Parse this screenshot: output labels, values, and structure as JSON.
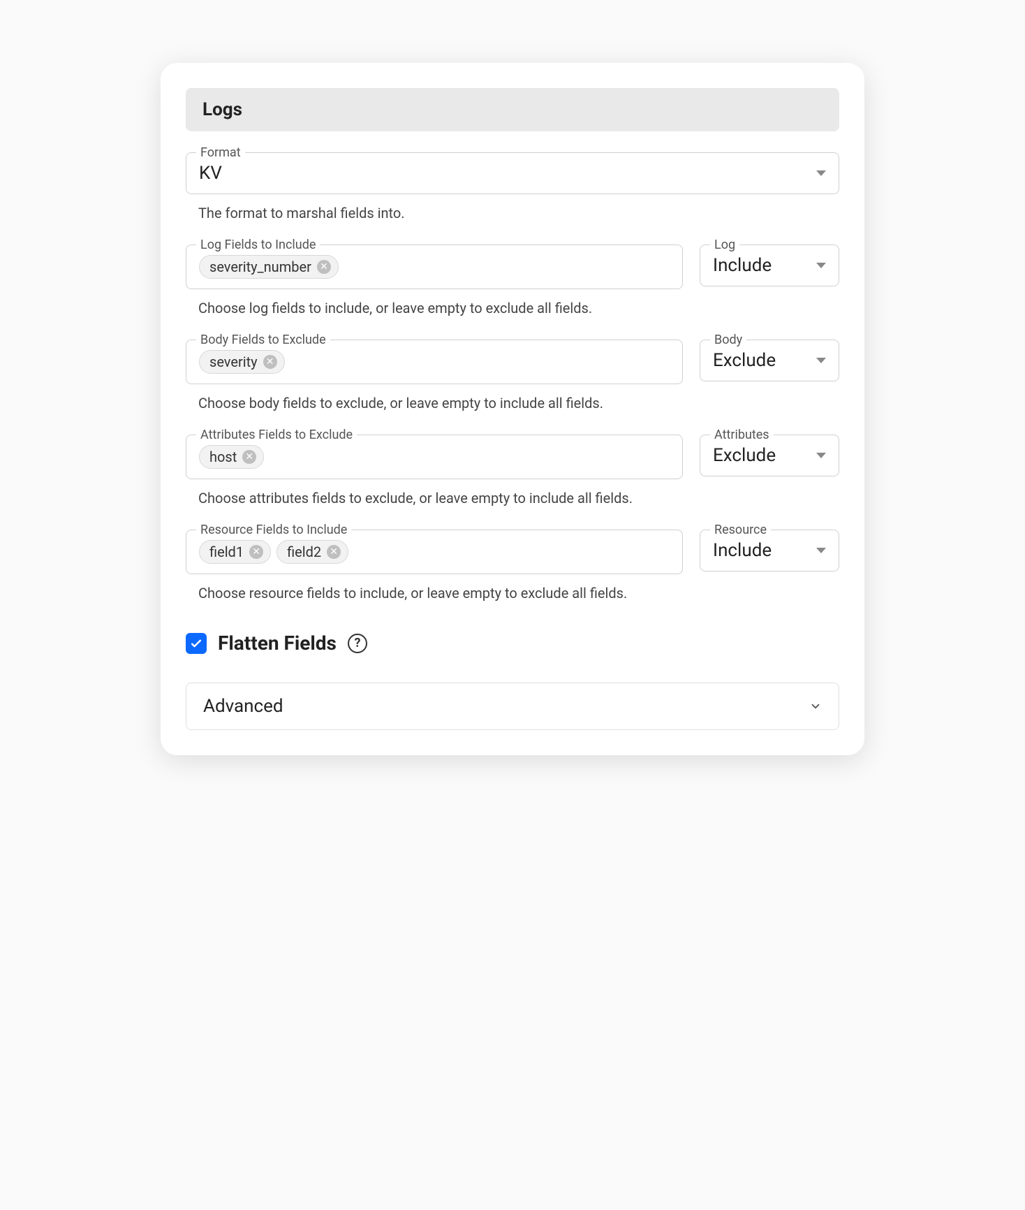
{
  "section_title": "Logs",
  "format": {
    "label": "Format",
    "value": "KV",
    "helper": "The format to marshal fields into."
  },
  "log_fields": {
    "label": "Log Fields to Include",
    "chips": [
      "severity_number"
    ],
    "helper": "Choose log fields to include, or leave empty to exclude all fields.",
    "mode_label": "Log",
    "mode_value": "Include"
  },
  "body_fields": {
    "label": "Body Fields to Exclude",
    "chips": [
      "severity"
    ],
    "helper": "Choose body fields to exclude, or leave empty to include all fields.",
    "mode_label": "Body",
    "mode_value": "Exclude"
  },
  "attributes_fields": {
    "label": "Attributes Fields to Exclude",
    "chips": [
      "host"
    ],
    "helper": "Choose attributes fields to exclude, or leave empty to include all fields.",
    "mode_label": "Attributes",
    "mode_value": "Exclude"
  },
  "resource_fields": {
    "label": "Resource Fields to Include",
    "chips": [
      "field1",
      "field2"
    ],
    "helper": "Choose resource fields to include, or leave empty to exclude all fields.",
    "mode_label": "Resource",
    "mode_value": "Include"
  },
  "flatten": {
    "label": "Flatten Fields",
    "checked": true
  },
  "advanced_label": "Advanced"
}
